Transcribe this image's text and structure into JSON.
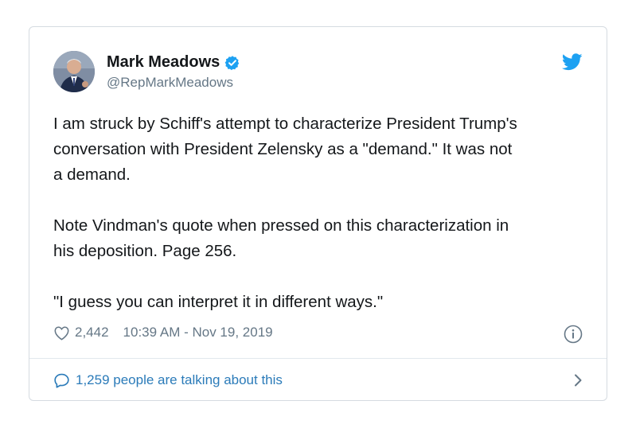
{
  "author": {
    "display_name": "Mark Meadows",
    "handle": "@RepMarkMeadows",
    "verified": true
  },
  "tweet": {
    "text": "I am struck by Schiff's attempt to characterize President Trump's\nconversation with President Zelensky as a \"demand.\" It was not\na demand.\n\nNote Vindman's quote when pressed on this characterization in\nhis deposition. Page 256.\n\n\"I guess you can interpret it in different ways.\""
  },
  "meta": {
    "likes": "2,442",
    "timestamp": "10:39 AM - Nov 19, 2019"
  },
  "footer": {
    "conversation_label": "1,259 people are talking about this"
  },
  "icons": {
    "brand": "twitter-bird-icon",
    "verified": "verified-badge-icon",
    "like": "heart-icon",
    "info": "info-icon",
    "conversation": "speech-bubble-icon",
    "chevron": "chevron-right-icon"
  },
  "colors": {
    "brand_blue": "#1da1f2",
    "link_blue": "#2b7bb9",
    "secondary_text": "#657786",
    "border": "#d5dbe1"
  }
}
